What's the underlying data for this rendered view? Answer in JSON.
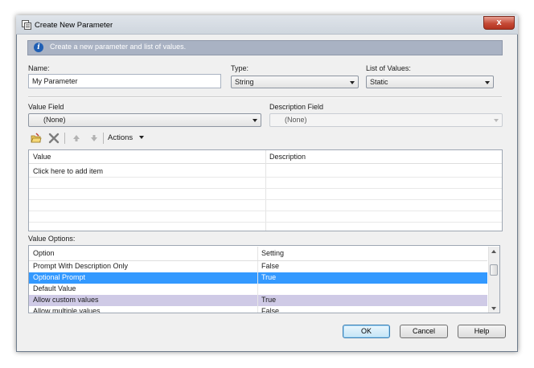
{
  "window": {
    "title": "Create New Parameter",
    "close_label": "x"
  },
  "info": {
    "text": "Create a new parameter and list of values."
  },
  "name": {
    "label": "Name:",
    "value": "My Parameter"
  },
  "type": {
    "label": "Type:",
    "value": "String"
  },
  "list_of_values": {
    "label": "List of Values:",
    "value": "Static"
  },
  "value_field": {
    "label": "Value Field",
    "value": "(None)"
  },
  "description_field": {
    "label": "Description Field",
    "value": "(None)"
  },
  "toolbar": {
    "actions_label": "Actions"
  },
  "values_grid": {
    "columns": [
      "Value",
      "Description"
    ],
    "placeholder_row": "Click here to add item"
  },
  "value_options": {
    "label": "Value Options:",
    "columns": [
      "Option",
      "Setting"
    ],
    "rows": [
      {
        "option": "Prompt With Description Only",
        "setting": "False"
      },
      {
        "option": "Optional Prompt",
        "setting": "True"
      },
      {
        "option": "Default Value",
        "setting": ""
      },
      {
        "option": "Allow custom values",
        "setting": "True"
      },
      {
        "option": "Allow multiple values",
        "setting": "False"
      }
    ]
  },
  "buttons": {
    "ok": "OK",
    "cancel": "Cancel",
    "help": "Help"
  }
}
